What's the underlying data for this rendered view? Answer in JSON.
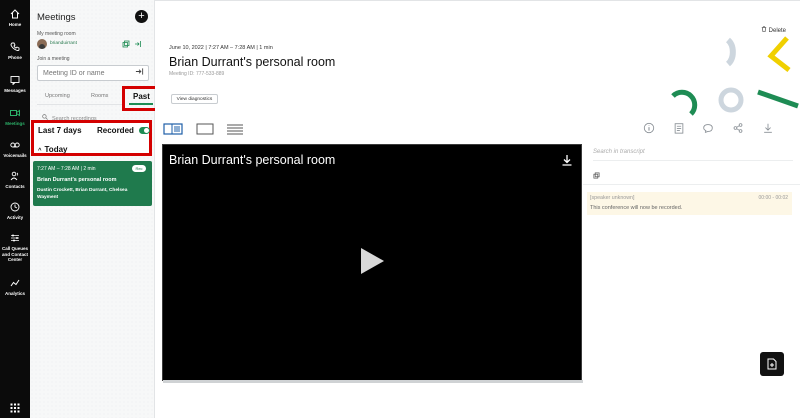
{
  "rail": {
    "items": [
      {
        "label": "Home"
      },
      {
        "label": "Phone"
      },
      {
        "label": "Messages"
      },
      {
        "label": "Meetings"
      },
      {
        "label": "Voicemails"
      },
      {
        "label": "Contacts"
      },
      {
        "label": "Activity"
      },
      {
        "label": "Call Queues and Contact Center"
      },
      {
        "label": "Analytics"
      }
    ],
    "active": "Meetings",
    "accent": "#2db36a"
  },
  "panel": {
    "title": "Meetings",
    "my_room_label": "My meeting room",
    "my_room_name": "brianduirrant",
    "join_label": "Join a meeting",
    "join_placeholder": "Meeting ID or name",
    "tabs": [
      "Upcoming",
      "Rooms",
      "Past"
    ],
    "selected_tab": "Past",
    "search_placeholder": "Search recordings",
    "filter_range": "Last 7 days",
    "recorded_label": "Recorded",
    "recorded_on": true,
    "group_label": "Today",
    "meeting_card": {
      "time": "7:27 AM – 7:28 AM  |  2 min",
      "badge": "Rec",
      "title": "Brian Durrant's personal room",
      "people": "Dustin Crockett, Brian Durrant, Chelsea Wayment"
    },
    "highlight_color": "#d40000",
    "card_color": "#1f7a4d"
  },
  "main": {
    "delete_label": "Delete",
    "meta": "June 10, 2022  |  7:27 AM – 7:28 AM  |  1 min",
    "title": "Brian Durrant's personal room",
    "meeting_id": "Meeting ID: 777-533-889",
    "diagnostics_label": "View diagnostics",
    "video_title": "Brian Durrant's personal room",
    "transcript": {
      "search_placeholder": "Search in transcript",
      "speaker": "[speaker unknown]",
      "timestamp": "00:00 - 00:02",
      "text": "This conference will now be recorded."
    }
  }
}
